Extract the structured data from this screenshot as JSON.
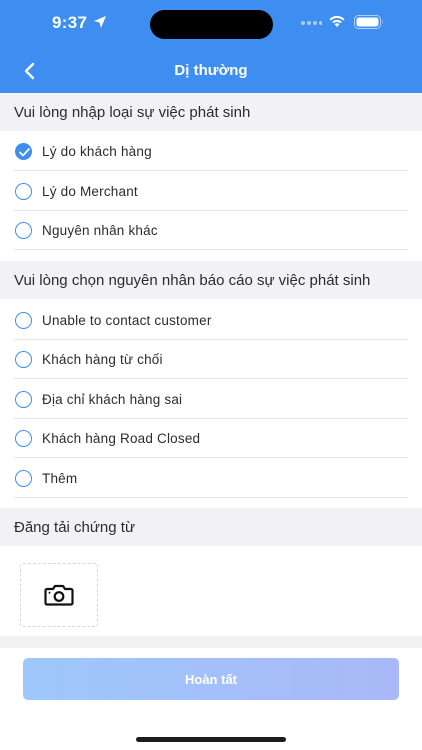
{
  "status_bar": {
    "time": "9:37"
  },
  "nav": {
    "title": "Dị thường",
    "back_icon": "chevron-left-icon"
  },
  "incident_type": {
    "header": "Vui lòng nhập loại sự việc phát sinh",
    "options": [
      {
        "label": "Lý do khách hàng",
        "checked": true
      },
      {
        "label": "Lý do Merchant",
        "checked": false
      },
      {
        "label": "Nguyên nhân khác",
        "checked": false
      }
    ]
  },
  "reason": {
    "header": "Vui lòng chọn nguyên nhân báo cáo sự việc phát sinh",
    "options": [
      {
        "label": "Unable to contact customer",
        "checked": false
      },
      {
        "label": "Khách hàng từ chối",
        "checked": false
      },
      {
        "label": "Địa chỉ khách hàng sai",
        "checked": false
      },
      {
        "label": "Khách hàng Road Closed",
        "checked": false
      },
      {
        "label": "Thêm",
        "checked": false
      }
    ]
  },
  "upload": {
    "header": "Đăng tải chứng từ",
    "icon": "camera-icon"
  },
  "footer": {
    "submit_label": "Hoàn tất"
  },
  "colors": {
    "primary": "#3d8ef0",
    "section_bg": "#f2f2f4",
    "button_gradient_start": "#9ec8fb",
    "button_gradient_end": "#a9b8f8"
  }
}
